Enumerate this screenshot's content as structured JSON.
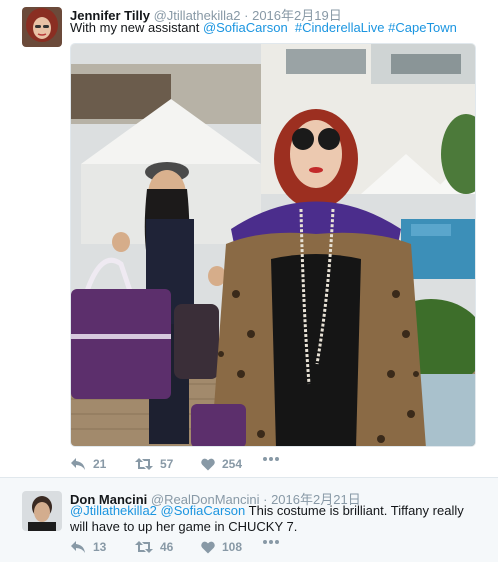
{
  "tweets": [
    {
      "name": "Jennifer Tilly",
      "handle": "@Jtillathekilla2",
      "separator": "·",
      "date": "2016年2月19日",
      "text_parts": [
        {
          "text": "With my new assistant ",
          "link": false
        },
        {
          "text": "@SofiaCarson",
          "link": true
        },
        {
          "text": "  ",
          "link": false
        },
        {
          "text": "#CinderellaLive",
          "link": true
        },
        {
          "text": " ",
          "link": false
        },
        {
          "text": "#CapeTown",
          "link": true
        }
      ],
      "actions": {
        "reply_count": "21",
        "retweet_count": "57",
        "like_count": "254"
      }
    },
    {
      "name": "Don Mancini",
      "handle": "@RealDonMancini",
      "separator": "·",
      "date": "2016年2月21日",
      "text_parts": [
        {
          "text": "@Jtillathekilla2",
          "link": true
        },
        {
          "text": " ",
          "link": false
        },
        {
          "text": "@SofiaCarson",
          "link": true
        },
        {
          "text": " This costume is brilliant. Tiffany really will have to up her game in CHUCKY 7.",
          "link": false
        }
      ],
      "actions": {
        "reply_count": "13",
        "retweet_count": "46",
        "like_count": "108"
      }
    }
  ],
  "colors": {
    "link": "#1b95e0",
    "muted": "#8899a6",
    "text": "#14171a",
    "border": "#e1e8ed"
  },
  "icons": [
    "reply-icon",
    "retweet-icon",
    "like-icon",
    "more-icon"
  ]
}
